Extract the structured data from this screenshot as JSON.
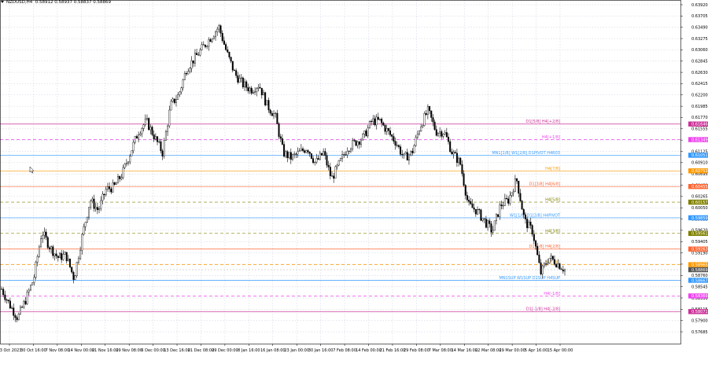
{
  "header": {
    "symbol": "NZDUSD,H4",
    "prices": "0.58912 0.58937 0.58837 0.58869"
  },
  "price_axis": {
    "ticks": [
      "0.63920",
      "0.63705",
      "0.63490",
      "0.63275",
      "0.63060",
      "0.62845",
      "0.62630",
      "0.62415",
      "0.62200",
      "0.61985",
      "0.61770",
      "0.61555",
      "0.61340",
      "0.61125",
      "0.60910",
      "0.60695",
      "0.60480",
      "0.60265",
      "0.60050",
      "0.59835",
      "0.59620",
      "0.59405",
      "0.59190",
      "0.58975",
      "0.58760",
      "0.58545",
      "0.58330",
      "0.58115",
      "0.57900",
      "0.57685"
    ]
  },
  "time_axis": {
    "ticks": [
      "23 Oct 2023",
      "30 Oct 16:00",
      "7 Nov 08:00",
      "14 Nov 00:00",
      "21 Nov 16:00",
      "29 Nov 08:00",
      "6 Dec 00:00",
      "13 Dec 16:00",
      "21 Dec 08:00",
      "29 Dec 00:00",
      "8 Jan 16:00",
      "16 Jan 08:00",
      "23 Jan 00:00",
      "30 Jan 16:00",
      "7 Feb 08:00",
      "14 Feb 00:00",
      "21 Feb 16:00",
      "29 Feb 08:00",
      "7 Mar 08:00",
      "14 Mar 16:00",
      "22 Mar 08:00",
      "29 Mar 00:00",
      "5 Apr 16:00",
      "15 Apr 00:00"
    ]
  },
  "levels": [
    {
      "label": "D1[5/8] H4[+2/8]",
      "price_tag": "0.61646",
      "color": "#cc3399",
      "dashed": false
    },
    {
      "label": "H4[+1/8]",
      "price_tag": "0.61349",
      "color": "#ee44ee",
      "dashed": true
    },
    {
      "label": "MN1[1/8] W1[2/8] D1PIVOT H4R03",
      "price_tag": "0.61051",
      "color": "#3399ff",
      "dashed": false
    },
    {
      "label": "H4[7/8]",
      "price_tag": "0.60753",
      "color": "#ff9900",
      "dashed": false
    },
    {
      "label": "D1[3/8] H4[6/8]",
      "price_tag": "0.60455",
      "color": "#ff6633",
      "dashed": false
    },
    {
      "label": "H4[5/8]",
      "price_tag": "0.60157",
      "color": "#808000",
      "dashed": true
    },
    {
      "label": "W1[1/8] D1[2/8] H4PIVOT",
      "price_tag": "0.59859",
      "color": "#3399ff",
      "dashed": false
    },
    {
      "label": "H4[3/8]",
      "price_tag": "0.59561",
      "color": "#808000",
      "dashed": true
    },
    {
      "label": "D1[1/8] H4[2/8]",
      "price_tag": "0.59263",
      "color": "#ff6633",
      "dashed": false
    },
    {
      "label": "H4[1/8]",
      "price_tag": "0.58965",
      "color": "#ff9900",
      "dashed": true
    },
    {
      "label": "MN1SUP W1SUP D1SUP H4SUP",
      "price_tag": "0.58667",
      "color": "#3399ff",
      "dashed": false
    },
    {
      "label": "H4[-1/8]",
      "price_tag": "0.58369",
      "color": "#ee44ee",
      "dashed": true
    },
    {
      "label": "D1[-1/8] H4[-2/8]",
      "price_tag": "0.58071",
      "color": "#cc3399",
      "dashed": false
    }
  ],
  "current_price_tag": {
    "price": "0.58869",
    "color": "#555555"
  },
  "colors": {
    "grid": "#c8cfe0",
    "candle": "#000000",
    "axis_text": "#000000"
  },
  "chart_data": {
    "type": "candlestick",
    "title": "",
    "y_range": [
      0.57685,
      0.6392
    ],
    "close_path": [
      [
        "23 Oct 2023",
        0.585
      ],
      [
        "25 Oct",
        0.582
      ],
      [
        "27 Oct",
        0.5795
      ],
      [
        "30 Oct 16:00",
        0.583
      ],
      [
        "1 Nov",
        0.587
      ],
      [
        "3 Nov",
        0.596
      ],
      [
        "6 Nov",
        0.593
      ],
      [
        "7 Nov 08:00",
        0.591
      ],
      [
        "9 Nov",
        0.5915
      ],
      [
        "10 Nov",
        0.587
      ],
      [
        "14 Nov 00:00",
        0.595
      ],
      [
        "15 Nov",
        0.602
      ],
      [
        "17 Nov",
        0.6
      ],
      [
        "20 Nov",
        0.604
      ],
      [
        "21 Nov 16:00",
        0.6045
      ],
      [
        "23 Nov",
        0.607
      ],
      [
        "27 Nov",
        0.611
      ],
      [
        "29 Nov 08:00",
        0.615
      ],
      [
        "1 Dec",
        0.617
      ],
      [
        "4 Dec",
        0.614
      ],
      [
        "6 Dec 00:00",
        0.611
      ],
      [
        "8 Dec",
        0.62
      ],
      [
        "11 Dec",
        0.622
      ],
      [
        "13 Dec 16:00",
        0.627
      ],
      [
        "15 Dec",
        0.629
      ],
      [
        "19 Dec",
        0.631
      ],
      [
        "21 Dec 08:00",
        0.633
      ],
      [
        "22 Dec",
        0.635
      ],
      [
        "27 Dec",
        0.63
      ],
      [
        "29 Dec 00:00",
        0.626
      ],
      [
        "2 Jan",
        0.624
      ],
      [
        "4 Jan",
        0.623
      ],
      [
        "8 Jan 16:00",
        0.624
      ],
      [
        "10 Jan",
        0.62
      ],
      [
        "12 Jan",
        0.618
      ],
      [
        "16 Jan 08:00",
        0.611
      ],
      [
        "18 Jan",
        0.61
      ],
      [
        "23 Jan 00:00",
        0.611
      ],
      [
        "25 Jan",
        0.612
      ],
      [
        "30 Jan 16:00",
        0.609
      ],
      [
        "1 Feb",
        0.611
      ],
      [
        "5 Feb",
        0.606
      ],
      [
        "7 Feb 08:00",
        0.609
      ],
      [
        "9 Feb",
        0.612
      ],
      [
        "14 Feb 00:00",
        0.613
      ],
      [
        "16 Feb",
        0.614
      ],
      [
        "19 Feb",
        0.617
      ],
      [
        "21 Feb 16:00",
        0.617
      ],
      [
        "23 Feb",
        0.615
      ],
      [
        "27 Feb",
        0.613
      ],
      [
        "29 Feb 08:00",
        0.61
      ],
      [
        "4 Mar",
        0.611
      ],
      [
        "7 Mar 08:00",
        0.616
      ],
      [
        "8 Mar",
        0.619
      ],
      [
        "12 Mar",
        0.615
      ],
      [
        "14 Mar 16:00",
        0.615
      ],
      [
        "18 Mar",
        0.611
      ],
      [
        "20 Mar",
        0.609
      ],
      [
        "22 Mar 08:00",
        0.601
      ],
      [
        "26 Mar",
        0.6
      ],
      [
        "29 Mar 00:00",
        0.598
      ],
      [
        "2 Apr",
        0.596
      ],
      [
        "3 Apr",
        0.601
      ],
      [
        "5 Apr 16:00",
        0.602
      ],
      [
        "9 Apr",
        0.606
      ],
      [
        "10 Apr",
        0.598
      ],
      [
        "12 Apr",
        0.596
      ],
      [
        "15 Apr 00:00",
        0.588
      ],
      [
        "16 Apr",
        0.591
      ],
      [
        "17 Apr",
        0.59
      ],
      [
        "18 Apr",
        0.5887
      ]
    ]
  }
}
